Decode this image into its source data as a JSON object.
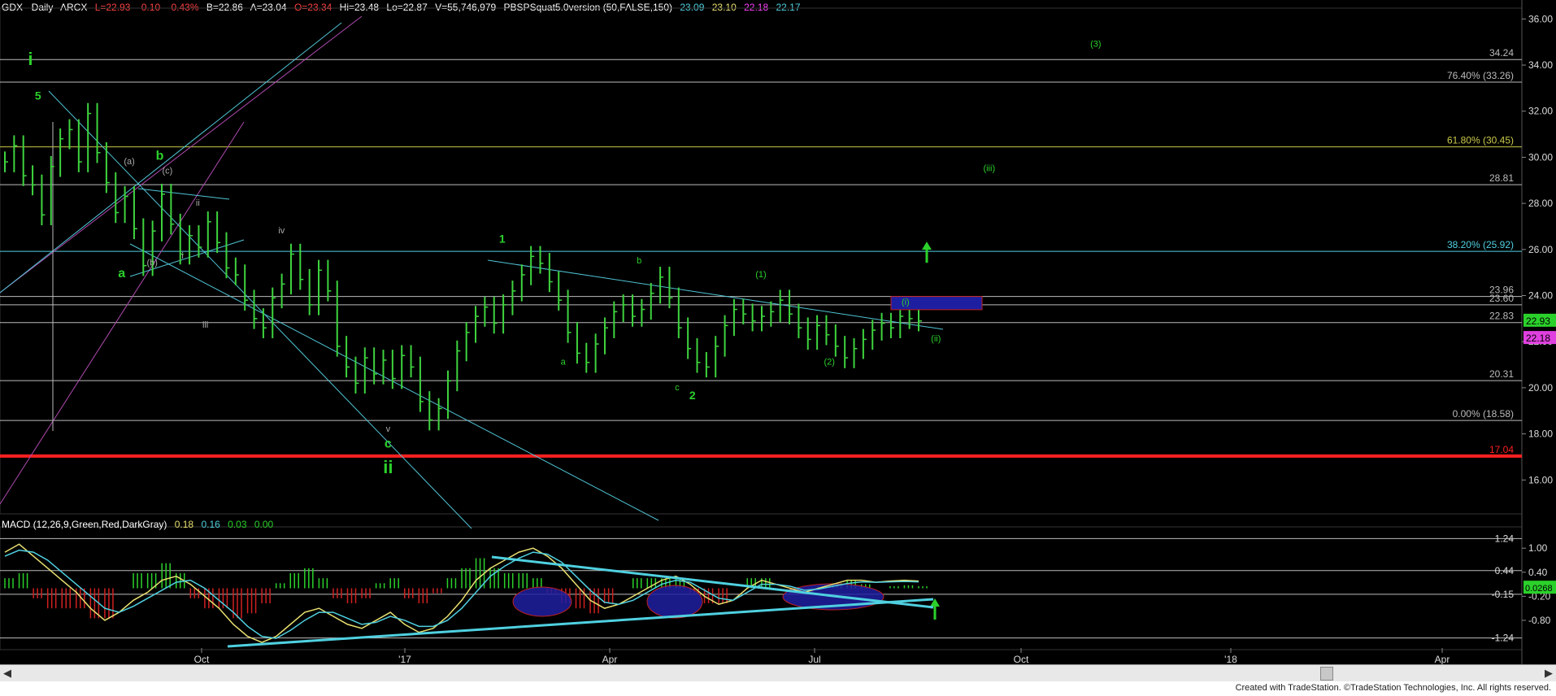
{
  "header": {
    "symbol": "GDX - Daily",
    "exchange": "ARCX",
    "last": "L=22.93",
    "change": "-0.10",
    "change_pct": "-0.43%",
    "bid": "B=22.86",
    "ask": "A=23.04",
    "open": "O=23.34",
    "high": "Hi=23.48",
    "low": "Lo=22.87",
    "volume": "V=55,746,979",
    "indicator": "PBSPSquat5.0version (50,FALSE,150)",
    "ind_values": [
      "23.09",
      "23.10",
      "22.18",
      "22.17"
    ],
    "ind_colors": [
      "#4fd0e0",
      "#e8e070",
      "#ff40ff",
      "#4fd0e0"
    ]
  },
  "macd_header": {
    "label": "MACD (12,26,9,Green,Red,DarkGray)",
    "values": [
      "0.18",
      "0.16",
      "0.03",
      "0.00"
    ],
    "colors": [
      "#e8e070",
      "#4fd0e0",
      "#2bd12b",
      "#2bd12b"
    ]
  },
  "footer": {
    "credit": "Created with TradeStation. ©TradeStation Technologies, Inc. All rights reserved."
  },
  "chart_data": {
    "type": "candlestick",
    "price_axis": {
      "min": 14.6,
      "max": 36.4,
      "ticks": [
        "16.00",
        "18.00",
        "20.00",
        "22.00",
        "24.00",
        "26.00",
        "28.00",
        "30.00",
        "32.00",
        "34.00",
        "36.00"
      ]
    },
    "time_axis": [
      "Oct",
      "'17",
      "Apr",
      "Jul",
      "Oct",
      "'18",
      "Apr"
    ],
    "prices": [
      29.8,
      30.5,
      29.2,
      28.8,
      27.5,
      29.6,
      30.8,
      31.2,
      29.8,
      31.9,
      30.2,
      28.9,
      27.6,
      28.3,
      26.9,
      25.3,
      26.8,
      28.4,
      27.1,
      25.8,
      26.6,
      26.1,
      27.2,
      26.3,
      25.2,
      24.9,
      23.8,
      23.0,
      22.6,
      23.9,
      24.5,
      25.8,
      24.7,
      23.6,
      25.1,
      24.2,
      21.8,
      20.9,
      20.2,
      21.3,
      20.6,
      21.2,
      20.4,
      21.4,
      20.9,
      19.4,
      18.6,
      19.1,
      20.3,
      21.6,
      22.4,
      23.1,
      23.5,
      22.8,
      23.6,
      24.2,
      24.9,
      25.7,
      25.4,
      24.6,
      23.8,
      22.4,
      21.5,
      21.1,
      21.9,
      22.6,
      23.3,
      23.6,
      23.1,
      23.4,
      24.1,
      24.8,
      23.9,
      22.6,
      21.7,
      21.1,
      20.9,
      21.8,
      22.7,
      23.4,
      23.2,
      22.9,
      23.1,
      23.3,
      23.8,
      23.2,
      22.6,
      22.1,
      22.7,
      22.3,
      21.8,
      21.3,
      21.7,
      22.1,
      22.5,
      22.8,
      22.6,
      23.1,
      23.0,
      22.9
    ],
    "levels": [
      {
        "price": 34.24,
        "label": "34.24"
      },
      {
        "price": 33.26,
        "label": "76.40% (33.26)"
      },
      {
        "price": 30.45,
        "label": "61.80% (30.45)",
        "color": "#c9c94a"
      },
      {
        "price": 28.81,
        "label": "28.81"
      },
      {
        "price": 25.92,
        "label": "38.20% (25.92)",
        "color": "#4fd0e0"
      },
      {
        "price": 23.96,
        "label": "23.96"
      },
      {
        "price": 23.6,
        "label": "23.60"
      },
      {
        "price": 22.83,
        "label": "22.83"
      },
      {
        "price": 20.31,
        "label": "20.31"
      },
      {
        "price": 18.58,
        "label": "0.00% (18.58)"
      },
      {
        "price": 17.04,
        "label": "17.04",
        "color": "#ff2020"
      }
    ],
    "last_price_tags": [
      {
        "price": 22.93,
        "label": "22.93",
        "color": "#2bd12b"
      },
      {
        "price": 22.18,
        "label": "22.18",
        "color": "#e040e0"
      }
    ],
    "wave_labels": [
      {
        "text": "i",
        "x": 0.02,
        "price": 34.0,
        "color": "#2bd12b",
        "size": 22
      },
      {
        "text": "5",
        "x": 0.025,
        "price": 32.5,
        "color": "#2bd12b",
        "size": 14
      },
      {
        "text": "b",
        "x": 0.105,
        "price": 29.9,
        "color": "#2bd12b",
        "size": 16
      },
      {
        "text": "(a)",
        "x": 0.085,
        "price": 29.7,
        "color": "#aaaaaa",
        "size": 11
      },
      {
        "text": "(c)",
        "x": 0.11,
        "price": 29.3,
        "color": "#aaaaaa",
        "size": 11
      },
      {
        "text": "ii",
        "x": 0.13,
        "price": 27.9,
        "color": "#aaaaaa",
        "size": 11
      },
      {
        "text": "a",
        "x": 0.08,
        "price": 24.8,
        "color": "#2bd12b",
        "size": 16
      },
      {
        "text": "(b)",
        "x": 0.1,
        "price": 25.3,
        "color": "#aaaaaa",
        "size": 11
      },
      {
        "text": "i",
        "x": 0.12,
        "price": 25.6,
        "color": "#aaaaaa",
        "size": 11
      },
      {
        "text": "iii",
        "x": 0.135,
        "price": 22.6,
        "color": "#aaaaaa",
        "size": 11
      },
      {
        "text": "iv",
        "x": 0.185,
        "price": 26.7,
        "color": "#aaaaaa",
        "size": 11
      },
      {
        "text": "v",
        "x": 0.255,
        "price": 18.1,
        "color": "#aaaaaa",
        "size": 11
      },
      {
        "text": "c",
        "x": 0.255,
        "price": 17.4,
        "color": "#2bd12b",
        "size": 16
      },
      {
        "text": "ii",
        "x": 0.255,
        "price": 16.3,
        "color": "#2bd12b",
        "size": 22
      },
      {
        "text": "1",
        "x": 0.33,
        "price": 26.3,
        "color": "#2bd12b",
        "size": 14
      },
      {
        "text": "a",
        "x": 0.37,
        "price": 21.0,
        "color": "#2bd12b",
        "size": 11
      },
      {
        "text": "b",
        "x": 0.42,
        "price": 25.4,
        "color": "#2bd12b",
        "size": 11
      },
      {
        "text": "c",
        "x": 0.445,
        "price": 19.9,
        "color": "#2bd12b",
        "size": 11
      },
      {
        "text": "2",
        "x": 0.455,
        "price": 19.5,
        "color": "#2bd12b",
        "size": 14
      },
      {
        "text": "(1)",
        "x": 0.5,
        "price": 24.8,
        "color": "#2bd12b",
        "size": 11
      },
      {
        "text": "(2)",
        "x": 0.545,
        "price": 21.0,
        "color": "#2bd12b",
        "size": 11
      },
      {
        "text": "(i)",
        "x": 0.595,
        "price": 23.6,
        "color": "#2bd12b",
        "size": 11
      },
      {
        "text": "(ii)",
        "x": 0.615,
        "price": 22.0,
        "color": "#2bd12b",
        "size": 11
      },
      {
        "text": "(iii)",
        "x": 0.65,
        "price": 29.4,
        "color": "#2bd12b",
        "size": 11
      },
      {
        "text": "(3)",
        "x": 0.72,
        "price": 34.8,
        "color": "#2bd12b",
        "size": 11
      }
    ],
    "macd": {
      "min": -1.45,
      "max": 1.45,
      "ticks": [
        "1.00",
        "0.40",
        "-0.20",
        "-0.80"
      ],
      "levels": [
        {
          "value": 1.24,
          "label": "1.24"
        },
        {
          "value": 0.44,
          "label": "0.44"
        },
        {
          "value": -0.15,
          "label": "-0.15"
        },
        {
          "value": -1.24,
          "label": "-1.24"
        }
      ],
      "tags": [
        {
          "value": 0.0268,
          "label": "0.0268",
          "color": "#2bd12b"
        }
      ],
      "macd_line": [
        0.9,
        1.1,
        0.8,
        0.5,
        0.2,
        -0.1,
        -0.5,
        -0.8,
        -0.6,
        -0.3,
        -0.1,
        0.2,
        0.3,
        0.1,
        -0.2,
        -0.5,
        -0.9,
        -1.2,
        -1.35,
        -1.2,
        -0.9,
        -0.6,
        -0.5,
        -0.7,
        -0.9,
        -1.0,
        -0.8,
        -0.6,
        -0.9,
        -1.1,
        -1.0,
        -0.7,
        -0.3,
        0.2,
        0.5,
        0.7,
        0.9,
        1.0,
        0.8,
        0.5,
        0.1,
        -0.3,
        -0.5,
        -0.4,
        -0.2,
        0.0,
        0.2,
        0.3,
        0.1,
        -0.2,
        -0.4,
        -0.3,
        0.0,
        0.2,
        0.1,
        0.0,
        -0.1,
        0.0,
        0.1,
        0.2,
        0.2,
        0.15,
        0.18,
        0.2,
        0.18
      ],
      "signal_line": [
        0.8,
        0.95,
        0.9,
        0.7,
        0.4,
        0.1,
        -0.2,
        -0.5,
        -0.6,
        -0.45,
        -0.25,
        -0.05,
        0.15,
        0.2,
        0.0,
        -0.3,
        -0.6,
        -0.95,
        -1.2,
        -1.25,
        -1.05,
        -0.8,
        -0.6,
        -0.6,
        -0.75,
        -0.9,
        -0.85,
        -0.7,
        -0.8,
        -0.95,
        -0.95,
        -0.8,
        -0.5,
        -0.1,
        0.3,
        0.55,
        0.75,
        0.9,
        0.85,
        0.65,
        0.3,
        -0.05,
        -0.35,
        -0.4,
        -0.3,
        -0.1,
        0.1,
        0.2,
        0.15,
        -0.05,
        -0.25,
        -0.3,
        -0.1,
        0.1,
        0.1,
        0.05,
        -0.05,
        -0.02,
        0.05,
        0.12,
        0.16,
        0.15,
        0.16,
        0.17,
        0.16
      ]
    }
  }
}
